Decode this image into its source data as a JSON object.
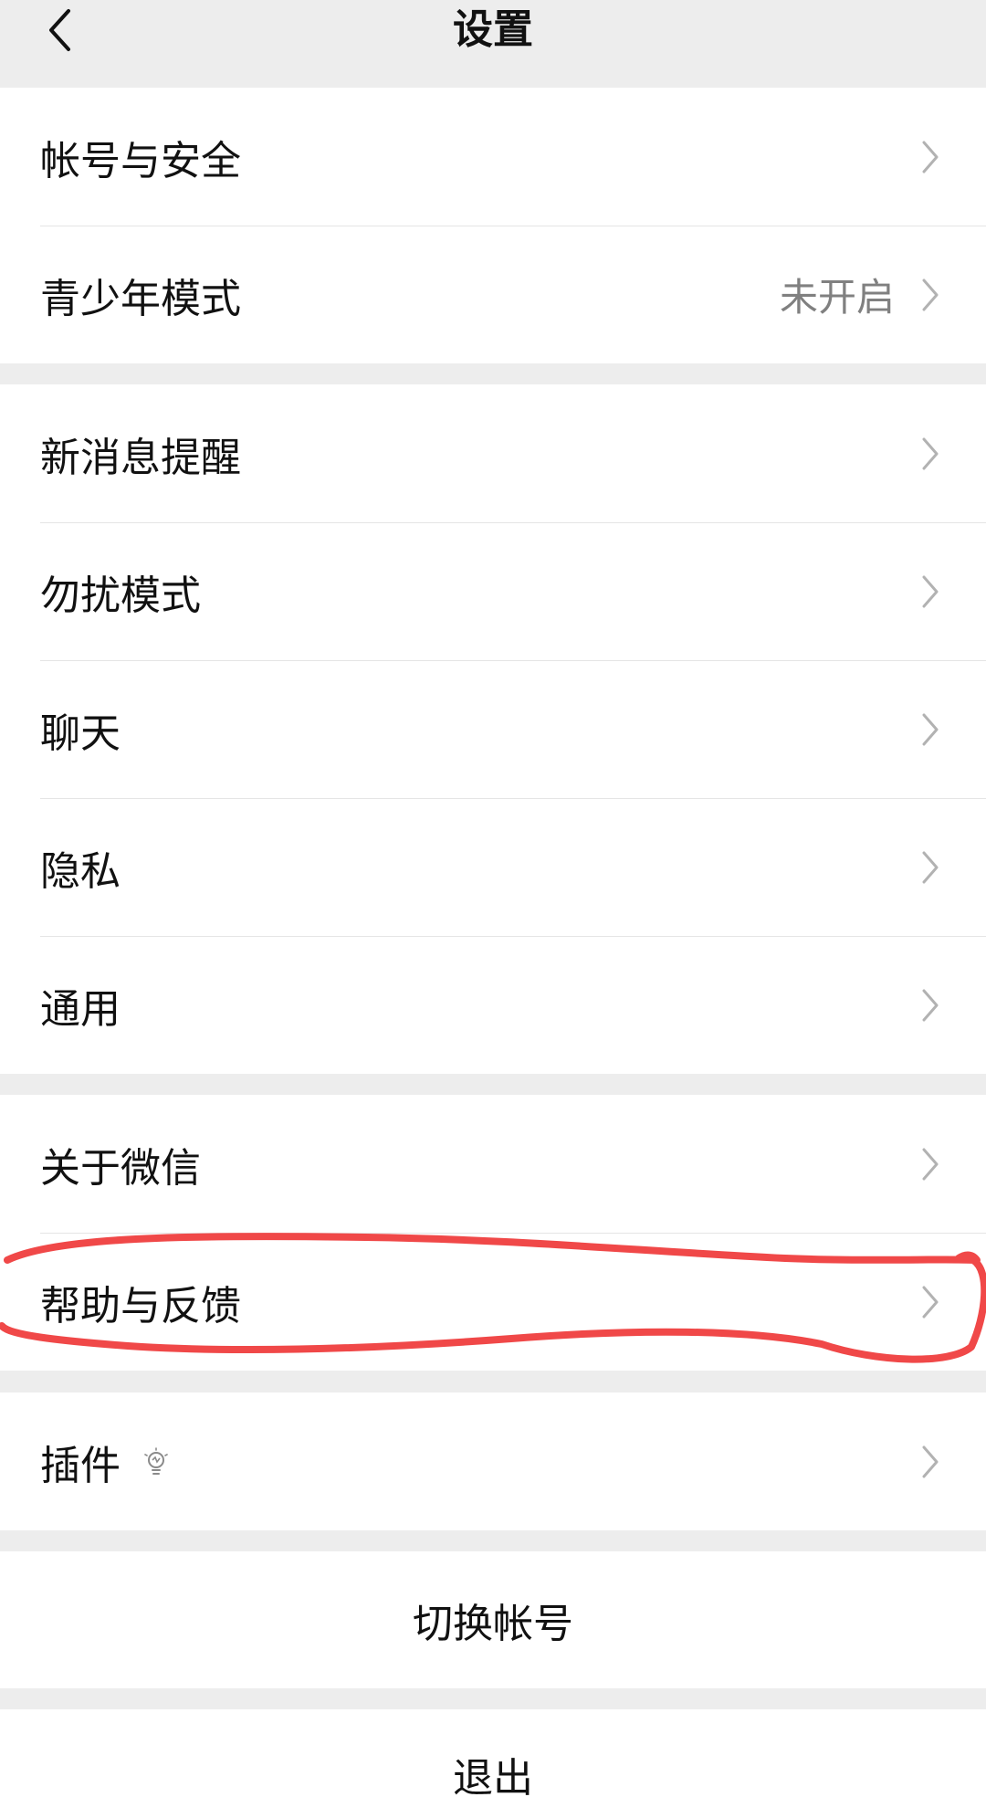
{
  "header": {
    "title": "设置",
    "back_icon": "chevron-left-icon"
  },
  "groups": [
    {
      "items": [
        {
          "label": "帐号与安全",
          "value": ""
        },
        {
          "label": "青少年模式",
          "value": "未开启"
        }
      ]
    },
    {
      "items": [
        {
          "label": "新消息提醒",
          "value": ""
        },
        {
          "label": "勿扰模式",
          "value": ""
        },
        {
          "label": "聊天",
          "value": ""
        },
        {
          "label": "隐私",
          "value": ""
        },
        {
          "label": "通用",
          "value": ""
        }
      ]
    },
    {
      "items": [
        {
          "label": "关于微信",
          "value": ""
        },
        {
          "label": "帮助与反馈",
          "value": ""
        }
      ]
    },
    {
      "items": [
        {
          "label": "插件",
          "value": "",
          "icon": "lightbulb-icon"
        }
      ]
    }
  ],
  "actions": {
    "switch_account": "切换帐号",
    "logout": "退出"
  },
  "colors": {
    "background": "#ededed",
    "group_background": "#ffffff",
    "value_text": "#808080",
    "chevron": "#b2b2b2",
    "annotation_stroke": "#f04848"
  }
}
